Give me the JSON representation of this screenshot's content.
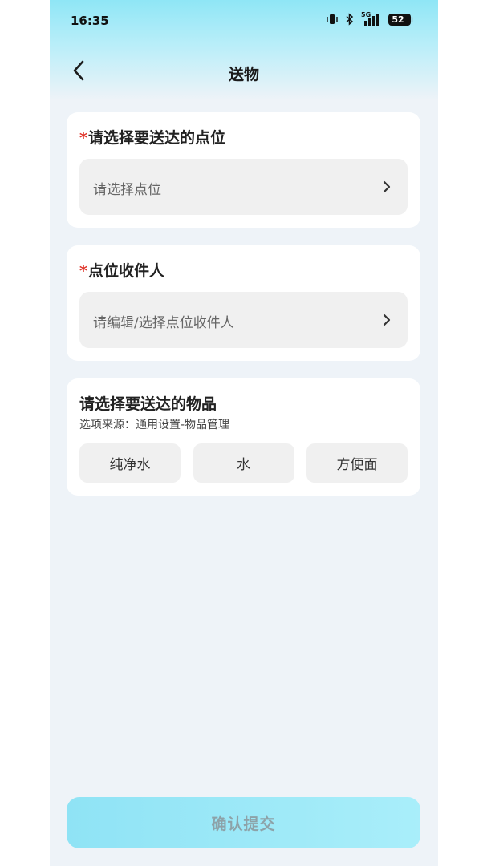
{
  "status_bar": {
    "time": "16:35",
    "network": "5G",
    "battery": "52",
    "icons": [
      "vibrate-icon",
      "bluetooth-icon",
      "signal-icon",
      "battery-icon"
    ]
  },
  "nav": {
    "back_icon": "chevron-left-icon",
    "title": "送物"
  },
  "point_section": {
    "required_mark": "*",
    "title": "请选择要送达的点位",
    "placeholder": "请选择点位",
    "icon": "chevron-right-icon"
  },
  "recipient_section": {
    "required_mark": "*",
    "title": "点位收件人",
    "placeholder": "请编辑/选择点位收件人",
    "icon": "chevron-right-icon"
  },
  "items_section": {
    "title": "请选择要送达的物品",
    "subtitle": "选项来源：通用设置-物品管理",
    "options": [
      "纯净水",
      "水",
      "方便面"
    ]
  },
  "submit": {
    "label": "确认提交"
  },
  "colors": {
    "accent_gradient_start": "#8fe3f5",
    "accent_gradient_end": "#a9eefa",
    "required": "#e0352b",
    "background": "#eef3f8"
  }
}
